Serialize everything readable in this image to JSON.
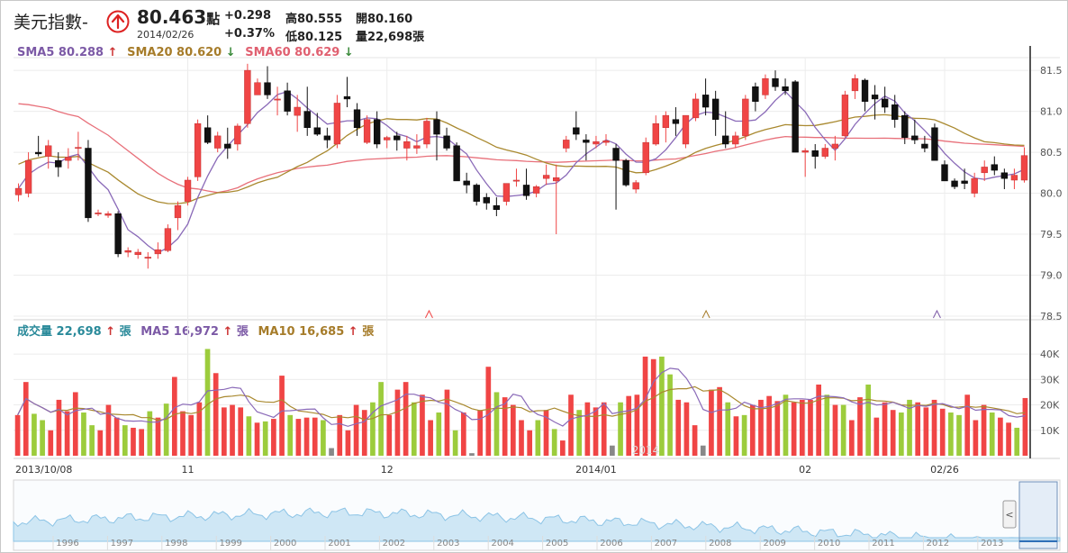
{
  "header": {
    "title": "美元指數-",
    "price": "80.463",
    "price_unit": "點",
    "date": "2014/02/26",
    "change": "+0.298",
    "change_pct": "+0.37%",
    "high": "高80.555",
    "low": "低80.125",
    "open": "開80.160",
    "volume": "量22,698張",
    "direction_icon": "up-arrow-circle-icon"
  },
  "price_indicators": {
    "sma5": {
      "text": "SMA5 80.288",
      "arrow": "↑",
      "color": "#7c5aa6",
      "arrow_color": "#cc3333"
    },
    "sma20": {
      "text": "SMA20 80.620",
      "arrow": "↓",
      "color": "#a67c2a",
      "arrow_color": "#3a8a3a"
    },
    "sma60": {
      "text": "SMA60 80.629",
      "arrow": "↓",
      "color": "#e06070",
      "arrow_color": "#3a8a3a"
    }
  },
  "volume_indicators": {
    "vol": {
      "text": "成交量 22,698",
      "arrow": "↑",
      "unit": "張",
      "color": "#2a8a9a",
      "arrow_color": "#cc3333"
    },
    "ma5": {
      "text": "MA5 16,972",
      "arrow": "↑",
      "unit": "張",
      "color": "#7c5aa6",
      "arrow_color": "#cc3333"
    },
    "ma10": {
      "text": "MA10 16,685",
      "arrow": "↑",
      "unit": "張",
      "color": "#a67c2a",
      "arrow_color": "#cc3333"
    }
  },
  "colors": {
    "up": "#f04545",
    "down": "#111111",
    "vol_up": "#f04545",
    "vol_down": "#9ccc3c",
    "vol_flat": "#888888",
    "sma5": "#8a6ab8",
    "sma20": "#a9892f",
    "sma60": "#e8707a",
    "nav": "#cfe7f5"
  },
  "navigator": {
    "years": [
      "1996",
      "1997",
      "1998",
      "1999",
      "2000",
      "2001",
      "2002",
      "2003",
      "2004",
      "2005",
      "2006",
      "2007",
      "2008",
      "2009",
      "2010",
      "2011",
      "2012",
      "2013"
    ],
    "scroll_button": "<"
  },
  "chart_data": {
    "type": "candlestick",
    "price_axis": {
      "ylim": [
        78.5,
        81.6
      ],
      "ticks": [
        "78.5",
        "79.0",
        "79.5",
        "80.0",
        "80.5",
        "81.0",
        "81.5"
      ]
    },
    "volume_axis": {
      "ylim": [
        0,
        45000
      ],
      "ticks": [
        "10K",
        "20K",
        "30K",
        "40K"
      ]
    },
    "x_labels": [
      {
        "label": "2013/10/08",
        "index": 0
      },
      {
        "label": "11",
        "index": 17
      },
      {
        "label": "12",
        "index": 37
      },
      {
        "label": "2014/01",
        "index": 58
      },
      {
        "label": "02",
        "index": 79
      },
      {
        "label": "02/26",
        "index": 93
      }
    ],
    "watermark": "2014",
    "ohlc": [
      [
        79.98,
        80.12,
        79.9,
        80.06
      ],
      [
        80.0,
        80.5,
        79.95,
        80.4
      ],
      [
        80.5,
        80.7,
        80.45,
        80.48
      ],
      [
        80.45,
        80.65,
        80.3,
        80.58
      ],
      [
        80.4,
        80.5,
        80.2,
        80.32
      ],
      [
        80.4,
        80.55,
        80.3,
        80.44
      ],
      [
        80.55,
        80.75,
        80.4,
        80.56
      ],
      [
        80.55,
        80.65,
        79.65,
        79.7
      ],
      [
        79.75,
        79.8,
        79.72,
        79.76
      ],
      [
        79.73,
        79.78,
        79.7,
        79.75
      ],
      [
        79.75,
        79.78,
        79.22,
        79.26
      ],
      [
        79.28,
        79.34,
        79.22,
        79.3
      ],
      [
        79.25,
        79.32,
        79.2,
        79.28
      ],
      [
        79.22,
        79.28,
        79.08,
        79.22
      ],
      [
        79.26,
        79.4,
        79.2,
        79.31
      ],
      [
        79.3,
        79.62,
        79.28,
        79.57
      ],
      [
        79.7,
        79.9,
        79.55,
        79.85
      ],
      [
        79.9,
        80.2,
        79.85,
        80.16
      ],
      [
        80.2,
        80.9,
        80.15,
        80.85
      ],
      [
        80.8,
        80.95,
        80.6,
        80.62
      ],
      [
        80.55,
        80.75,
        80.5,
        80.7
      ],
      [
        80.6,
        80.8,
        80.42,
        80.55
      ],
      [
        80.6,
        80.85,
        80.52,
        80.82
      ],
      [
        80.85,
        81.58,
        80.8,
        81.5
      ],
      [
        81.2,
        81.4,
        81.2,
        81.35
      ],
      [
        81.35,
        81.55,
        81.15,
        81.2
      ],
      [
        81.15,
        81.3,
        80.95,
        81.15
      ],
      [
        81.25,
        81.35,
        80.95,
        81.0
      ],
      [
        80.95,
        81.2,
        80.75,
        81.05
      ],
      [
        81.0,
        81.3,
        80.7,
        80.8
      ],
      [
        80.8,
        80.98,
        80.7,
        80.72
      ],
      [
        80.7,
        80.8,
        80.55,
        80.65
      ],
      [
        80.6,
        81.2,
        80.55,
        81.1
      ],
      [
        81.18,
        81.42,
        81.05,
        81.15
      ],
      [
        81.02,
        81.1,
        80.7,
        80.8
      ],
      [
        80.62,
        80.95,
        80.6,
        80.9
      ],
      [
        80.9,
        81.0,
        80.55,
        80.6
      ],
      [
        80.65,
        80.7,
        80.55,
        80.68
      ],
      [
        80.7,
        80.75,
        80.52,
        80.65
      ],
      [
        80.55,
        80.7,
        80.4,
        80.63
      ],
      [
        80.55,
        80.72,
        80.48,
        80.58
      ],
      [
        80.6,
        80.92,
        80.55,
        80.88
      ],
      [
        80.9,
        81.0,
        80.4,
        80.72
      ],
      [
        80.7,
        80.8,
        80.52,
        80.55
      ],
      [
        80.58,
        80.62,
        80.15,
        80.15
      ],
      [
        80.15,
        80.25,
        80.0,
        80.1
      ],
      [
        80.1,
        80.12,
        79.85,
        79.9
      ],
      [
        79.95,
        80.0,
        79.8,
        79.88
      ],
      [
        79.85,
        79.95,
        79.72,
        79.8
      ],
      [
        79.9,
        80.12,
        79.85,
        80.12
      ],
      [
        80.15,
        80.3,
        80.08,
        80.16
      ],
      [
        80.1,
        80.3,
        79.92,
        79.97
      ],
      [
        80.0,
        80.1,
        79.95,
        80.08
      ],
      [
        80.18,
        80.35,
        80.1,
        80.22
      ],
      [
        80.15,
        80.35,
        79.5,
        80.19
      ],
      [
        80.55,
        80.7,
        80.5,
        80.65
      ],
      [
        80.8,
        81.0,
        80.65,
        80.72
      ],
      [
        80.65,
        80.72,
        80.4,
        80.62
      ],
      [
        80.6,
        80.7,
        80.55,
        80.63
      ],
      [
        80.62,
        80.72,
        80.58,
        80.64
      ],
      [
        80.55,
        80.6,
        79.8,
        80.4
      ],
      [
        80.4,
        80.42,
        80.08,
        80.1
      ],
      [
        80.05,
        80.16,
        80.0,
        80.13
      ],
      [
        80.25,
        80.68,
        80.22,
        80.62
      ],
      [
        80.6,
        80.95,
        80.58,
        80.85
      ],
      [
        80.8,
        81.0,
        80.62,
        80.95
      ],
      [
        80.9,
        81.05,
        80.7,
        80.85
      ],
      [
        80.6,
        80.95,
        80.55,
        80.95
      ],
      [
        80.92,
        81.22,
        80.88,
        81.15
      ],
      [
        81.2,
        81.4,
        80.95,
        81.05
      ],
      [
        81.15,
        81.25,
        80.7,
        80.9
      ],
      [
        80.7,
        81.0,
        80.55,
        80.6
      ],
      [
        80.6,
        80.75,
        80.55,
        80.7
      ],
      [
        80.7,
        81.2,
        80.65,
        81.15
      ],
      [
        81.3,
        81.35,
        81.0,
        81.12
      ],
      [
        81.2,
        81.45,
        81.15,
        81.4
      ],
      [
        81.4,
        81.5,
        81.25,
        81.3
      ],
      [
        81.3,
        81.4,
        81.2,
        81.25
      ],
      [
        81.36,
        81.38,
        80.5,
        80.5
      ],
      [
        80.5,
        80.55,
        80.2,
        80.52
      ],
      [
        80.52,
        80.6,
        80.3,
        80.45
      ],
      [
        80.45,
        80.6,
        80.42,
        80.55
      ],
      [
        80.55,
        80.7,
        80.4,
        80.6
      ],
      [
        80.7,
        81.25,
        80.68,
        81.2
      ],
      [
        81.25,
        81.45,
        81.15,
        81.4
      ],
      [
        81.38,
        81.4,
        81.0,
        81.12
      ],
      [
        81.2,
        81.32,
        80.9,
        81.15
      ],
      [
        81.15,
        81.3,
        80.98,
        81.05
      ],
      [
        81.08,
        81.2,
        80.8,
        80.9
      ],
      [
        80.95,
        81.0,
        80.6,
        80.68
      ],
      [
        80.7,
        80.9,
        80.6,
        80.65
      ],
      [
        80.6,
        80.7,
        80.5,
        80.55
      ],
      [
        80.8,
        80.85,
        80.4,
        80.4
      ],
      [
        80.35,
        80.4,
        80.15,
        80.15
      ],
      [
        80.15,
        80.18,
        80.05,
        80.08
      ],
      [
        80.15,
        80.3,
        80.05,
        80.12
      ],
      [
        80.0,
        80.25,
        79.95,
        80.18
      ],
      [
        80.25,
        80.4,
        80.15,
        80.32
      ],
      [
        80.35,
        80.45,
        80.22,
        80.28
      ],
      [
        80.25,
        80.3,
        80.05,
        80.18
      ],
      [
        80.16,
        80.3,
        80.05,
        80.22
      ],
      [
        80.16,
        80.56,
        80.13,
        80.46
      ]
    ],
    "volume": [
      16000,
      29000,
      16500,
      14000,
      10000,
      22000,
      17500,
      25000,
      17000,
      12000,
      10000,
      20000,
      15000,
      12000,
      11000,
      10500,
      17500,
      15000,
      20500,
      31000,
      17500,
      16000,
      21000,
      42000,
      32500,
      19000,
      20000,
      19000,
      15500,
      13000,
      13500,
      14500,
      31500,
      16000,
      14500,
      15000,
      15000,
      14000,
      3000,
      16000,
      10000,
      20000,
      18000,
      21000,
      29000,
      16000,
      26000,
      29000,
      21000,
      24000,
      14000,
      17000,
      26000,
      10000,
      17000,
      1000,
      18000,
      35000,
      25000,
      23000,
      20000,
      14000,
      10000,
      14000,
      18000,
      10500,
      6000,
      24000,
      18000,
      21000,
      19000,
      21000,
      4000,
      21000,
      23500,
      24000,
      39000,
      38000,
      39000,
      32000,
      22000,
      21000,
      12000,
      4000,
      26000,
      27000,
      21000,
      15500,
      16000,
      20000,
      22000,
      23500,
      21500,
      24000,
      21000,
      22000,
      22000,
      28000,
      24000,
      20000,
      20000,
      14000,
      23000,
      28000,
      15000,
      21000,
      18000,
      17000,
      22000,
      21000,
      19000,
      22000,
      18500,
      17000,
      16000,
      24000,
      14000,
      20000,
      17000,
      15000,
      13000,
      11000,
      22698
    ]
  }
}
